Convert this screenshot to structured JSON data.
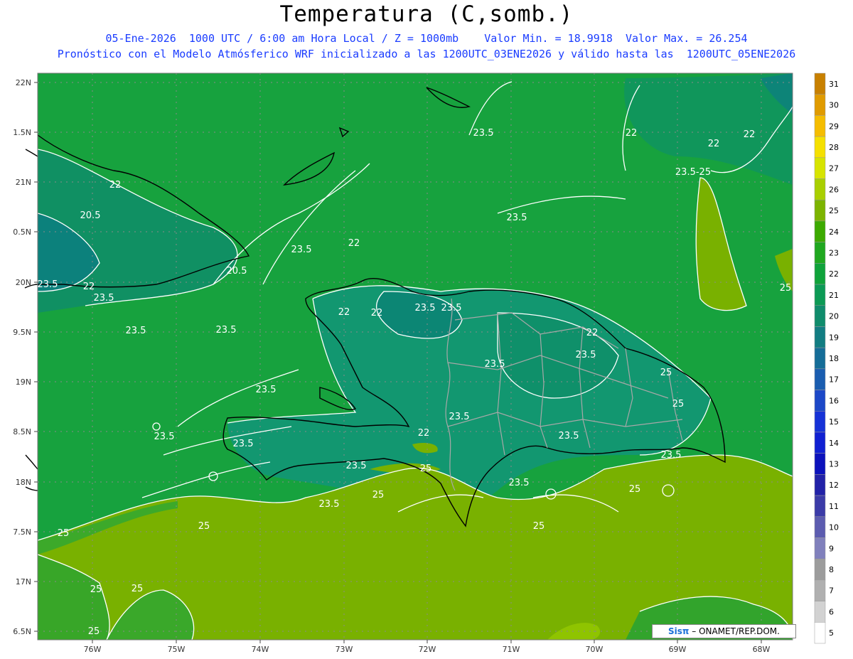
{
  "header": {
    "title": "Temperatura (C,somb.)",
    "line1": "05-Ene-2026  1000 UTC / 6:00 am Hora Local / Z = 1000mb    Valor Min. = 18.9918  Valor Max. = 26.254",
    "line2": "Pronóstico con el Modelo Atmósferico WRF inicializado a las 1200UTC_03ENE2026 y válido hasta las  1200UTC_05ENE2026"
  },
  "map": {
    "lat_labels": [
      "22N",
      "1.5N",
      "21N",
      "0.5N",
      "20N",
      "9.5N",
      "19N",
      "8.5N",
      "18N",
      "7.5N",
      "17N",
      "6.5N"
    ],
    "lon_labels": [
      "76W",
      "75W",
      "74W",
      "73W",
      "72W",
      "71W",
      "70W",
      "69W",
      "68W"
    ],
    "contour_labels": [
      "23.5",
      "22",
      "22",
      "22",
      "22",
      "23.5-25",
      "20.5",
      "23.5",
      "23.5",
      "22",
      "20.5",
      "23.5",
      "22",
      "23.5",
      "23.5",
      "23.5",
      "22",
      "22",
      "23.5",
      "23.5",
      "22",
      "23.5",
      "23.5",
      "25",
      "25",
      "23.5",
      "23.5",
      "22",
      "23.5",
      "23.5",
      "23.5",
      "23.5",
      "23.5",
      "25",
      "23.5",
      "23.5",
      "25",
      "25",
      "25",
      "25",
      "25",
      "25",
      "25",
      "25",
      "25"
    ]
  },
  "colorbar": {
    "levels": [
      "31",
      "30",
      "29",
      "28",
      "27",
      "26",
      "25",
      "24",
      "23",
      "22",
      "21",
      "20",
      "19",
      "18",
      "17",
      "16",
      "15",
      "14",
      "13",
      "12",
      "11",
      "10",
      "9",
      "8",
      "7",
      "6",
      "5"
    ],
    "colors": [
      "#c88000",
      "#e09b00",
      "#f5bd00",
      "#f5e000",
      "#d7e400",
      "#a9cf00",
      "#7cb400",
      "#3caa00",
      "#1fa81f",
      "#0fa33a",
      "#0c9a55",
      "#108c6c",
      "#127d82",
      "#156d98",
      "#1a5db0",
      "#1c48c8",
      "#1632d7",
      "#1020d2",
      "#0c12bc",
      "#2222a8",
      "#3b3ba8",
      "#5c5cb0",
      "#8080bc",
      "#9c9c9c",
      "#b0b0b0",
      "#d2d2d2",
      "#ffffff"
    ]
  },
  "credit": {
    "logo": "Sisπ",
    "text": "– ONAMET/REP.DOM."
  }
}
